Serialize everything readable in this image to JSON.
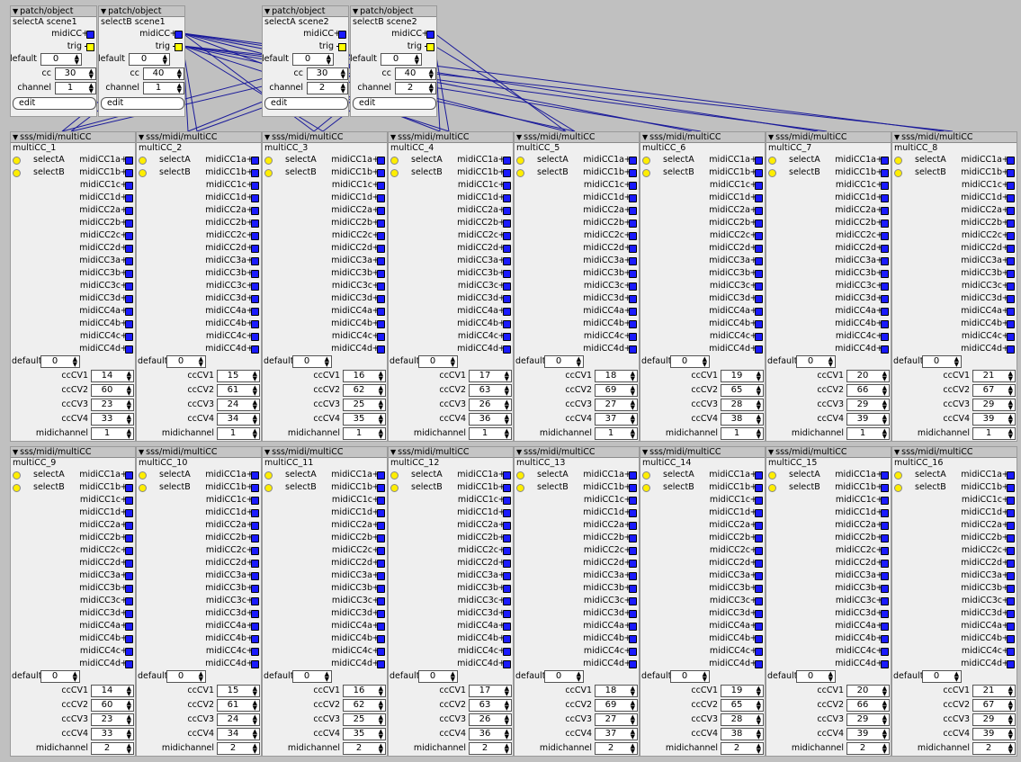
{
  "patch_objects": [
    {
      "header": "patch/object",
      "name": "selectA scene1",
      "outlet_midicc": "midiCC",
      "outlet_trig": "trig",
      "default_label": "default",
      "default_value": "0",
      "cc_label": "cc",
      "cc_value": "30",
      "channel_label": "channel",
      "channel_value": "1",
      "edit_label": "edit"
    },
    {
      "header": "patch/object",
      "name": "selectB scene1",
      "outlet_midicc": "midiCC",
      "outlet_trig": "trig",
      "default_label": "default",
      "default_value": "0",
      "cc_label": "cc",
      "cc_value": "40",
      "channel_label": "channel",
      "channel_value": "1",
      "edit_label": "edit"
    },
    {
      "header": "patch/object",
      "name": "selectA scene2",
      "outlet_midicc": "midiCC",
      "outlet_trig": "trig",
      "default_label": "default",
      "default_value": "0",
      "cc_label": "cc",
      "cc_value": "30",
      "channel_label": "channel",
      "channel_value": "2",
      "edit_label": "edit"
    },
    {
      "header": "patch/object",
      "name": "selectB scene2",
      "outlet_midicc": "midiCC",
      "outlet_trig": "trig",
      "default_label": "default",
      "default_value": "0",
      "cc_label": "cc",
      "cc_value": "40",
      "channel_label": "channel",
      "channel_value": "2",
      "edit_label": "edit"
    }
  ],
  "multicc_header": "sss/midi/multiCC",
  "inlets": [
    "selectA",
    "selectB"
  ],
  "outlets": [
    "midiCC1a",
    "midiCC1b",
    "midiCC1c",
    "midiCC1d",
    "midiCC2a",
    "midiCC2b",
    "midiCC2c",
    "midiCC2d",
    "midiCC3a",
    "midiCC3b",
    "midiCC3c",
    "midiCC3d",
    "midiCC4a",
    "midiCC4b",
    "midiCC4c",
    "midiCC4d"
  ],
  "labels": {
    "default": "default",
    "ccCV1": "ccCV1",
    "ccCV2": "ccCV2",
    "ccCV3": "ccCV3",
    "ccCV4": "ccCV4",
    "midichannel": "midichannel"
  },
  "multicc_objects": [
    {
      "name": "multiCC_1",
      "default": "0",
      "cc": [
        "14",
        "60",
        "23",
        "33"
      ],
      "midichannel": "1"
    },
    {
      "name": "multiCC_2",
      "default": "0",
      "cc": [
        "15",
        "61",
        "24",
        "34"
      ],
      "midichannel": "1"
    },
    {
      "name": "multiCC_3",
      "default": "0",
      "cc": [
        "16",
        "62",
        "25",
        "35"
      ],
      "midichannel": "1"
    },
    {
      "name": "multiCC_4",
      "default": "0",
      "cc": [
        "17",
        "63",
        "26",
        "36"
      ],
      "midichannel": "1"
    },
    {
      "name": "multiCC_5",
      "default": "0",
      "cc": [
        "18",
        "69",
        "27",
        "37"
      ],
      "midichannel": "1"
    },
    {
      "name": "multiCC_6",
      "default": "0",
      "cc": [
        "19",
        "65",
        "28",
        "38"
      ],
      "midichannel": "1"
    },
    {
      "name": "multiCC_7",
      "default": "0",
      "cc": [
        "20",
        "66",
        "29",
        "39"
      ],
      "midichannel": "1"
    },
    {
      "name": "multiCC_8",
      "default": "0",
      "cc": [
        "21",
        "67",
        "29",
        "39"
      ],
      "midichannel": "1"
    },
    {
      "name": "multiCC_9",
      "default": "0",
      "cc": [
        "14",
        "60",
        "23",
        "33"
      ],
      "midichannel": "2"
    },
    {
      "name": "multiCC_10",
      "default": "0",
      "cc": [
        "15",
        "61",
        "24",
        "34"
      ],
      "midichannel": "2"
    },
    {
      "name": "multiCC_11",
      "default": "0",
      "cc": [
        "16",
        "62",
        "25",
        "35"
      ],
      "midichannel": "2"
    },
    {
      "name": "multiCC_12",
      "default": "0",
      "cc": [
        "17",
        "63",
        "26",
        "36"
      ],
      "midichannel": "2"
    },
    {
      "name": "multiCC_13",
      "default": "0",
      "cc": [
        "18",
        "69",
        "27",
        "37"
      ],
      "midichannel": "2"
    },
    {
      "name": "multiCC_14",
      "default": "0",
      "cc": [
        "19",
        "65",
        "28",
        "38"
      ],
      "midichannel": "2"
    },
    {
      "name": "multiCC_15",
      "default": "0",
      "cc": [
        "20",
        "66",
        "29",
        "39"
      ],
      "midichannel": "2"
    },
    {
      "name": "multiCC_16",
      "default": "0",
      "cc": [
        "21",
        "67",
        "29",
        "39"
      ],
      "midichannel": "2"
    }
  ],
  "colors": {
    "canvas": "#c0c0c0",
    "object": "#efefef",
    "header": "#c4c4c4",
    "wire": "#1a1a9a",
    "outlet": "#1a1aff",
    "inlet": "#ffee00"
  }
}
